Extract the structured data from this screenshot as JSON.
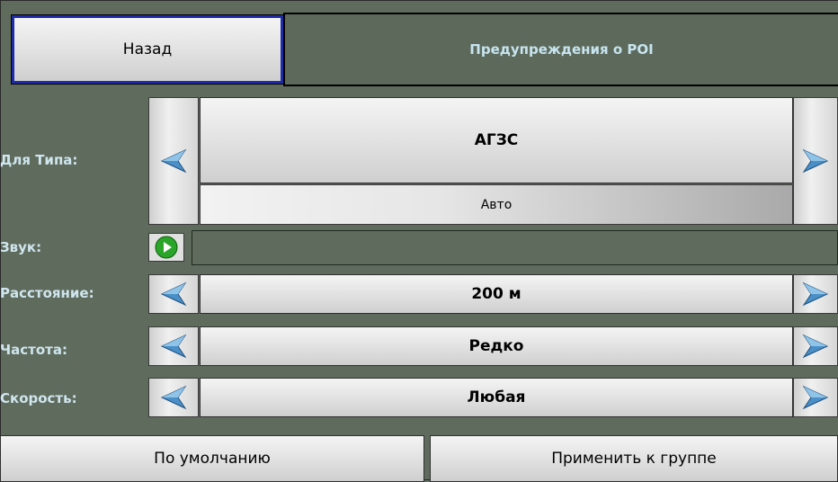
{
  "header": {
    "back_label": "Назад",
    "title": "Предупреждения о POI"
  },
  "rows": {
    "type": {
      "label": "Для Типа:",
      "value": "АГЗС",
      "sub_value": "Авто"
    },
    "sound": {
      "label": "Звук:"
    },
    "distance": {
      "label": "Расстояние:",
      "value": "200 м"
    },
    "frequency": {
      "label": "Частота:",
      "value": "Редко"
    },
    "speed": {
      "label": "Скорость:",
      "value": "Любая"
    }
  },
  "footer": {
    "default_label": "По умолчанию",
    "apply_group_label": "Применить к группе"
  },
  "colors": {
    "background": "#5f6b5d",
    "label_text": "#cfe6ee",
    "back_border": "#1f2ca8",
    "arrow_blue": "#4a8fc7",
    "play_green": "#2aa52a"
  },
  "icons": {
    "left_arrow": "arrow-left-icon",
    "right_arrow": "arrow-right-icon",
    "play": "play-icon"
  }
}
